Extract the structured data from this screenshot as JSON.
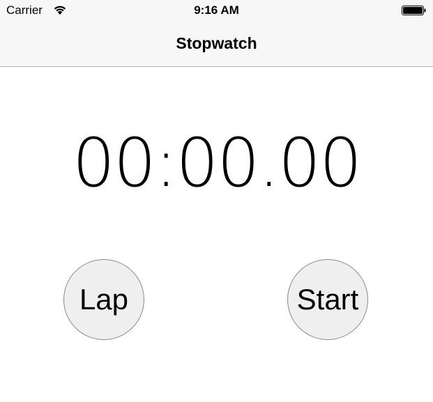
{
  "status_bar": {
    "carrier": "Carrier",
    "time": "9:16 AM",
    "wifi_icon": "wifi-icon",
    "battery_icon": "battery-icon"
  },
  "nav": {
    "title": "Stopwatch"
  },
  "stopwatch": {
    "display": "00:00.00"
  },
  "buttons": {
    "lap_label": "Lap",
    "start_label": "Start"
  },
  "colors": {
    "bar_background": "#f7f7f7",
    "button_background": "#efefef",
    "button_border": "#8a8a8a"
  }
}
